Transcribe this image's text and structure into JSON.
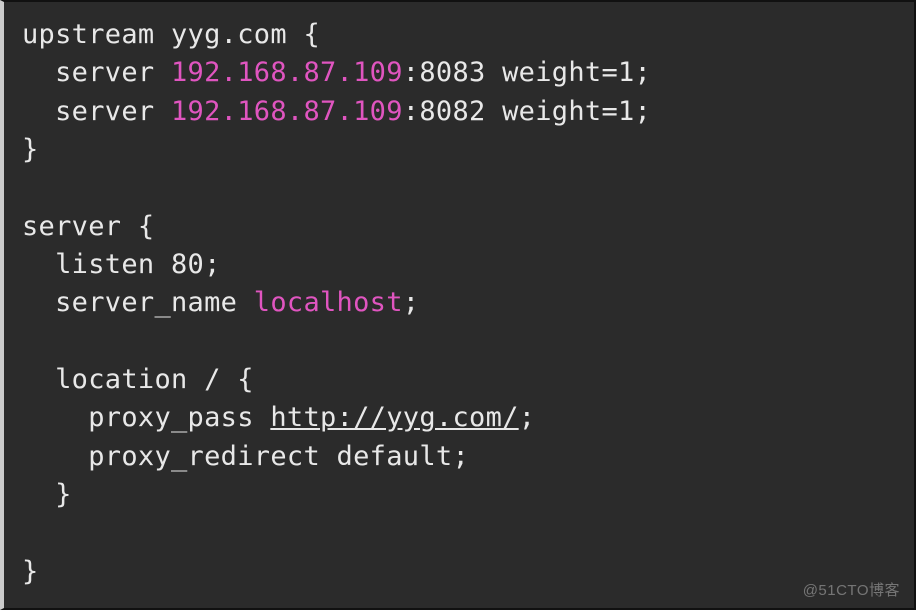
{
  "code": {
    "line1_a": "upstream yyg.com {",
    "line2_a": "  server ",
    "line2_ip": "192.168.87.109",
    "line2_b": ":8083 weight=1;",
    "line3_a": "  server ",
    "line3_ip": "192.168.87.109",
    "line3_b": ":8082 weight=1;",
    "line4_a": "}",
    "line5_blank": "",
    "line6_a": "server {",
    "line7_a": "  listen 80;",
    "line8_a": "  server_name ",
    "line8_host": "localhost",
    "line8_b": ";",
    "line9_blank": "",
    "line10_a": "  location / {",
    "line11_a": "    proxy_pass ",
    "line11_url": "http://yyg.com/",
    "line11_b": ";",
    "line12_a": "    proxy_redirect default;",
    "line13_a": "  }",
    "line14_blank": "",
    "line15_a": "}"
  },
  "watermark": "@51CTO博客"
}
